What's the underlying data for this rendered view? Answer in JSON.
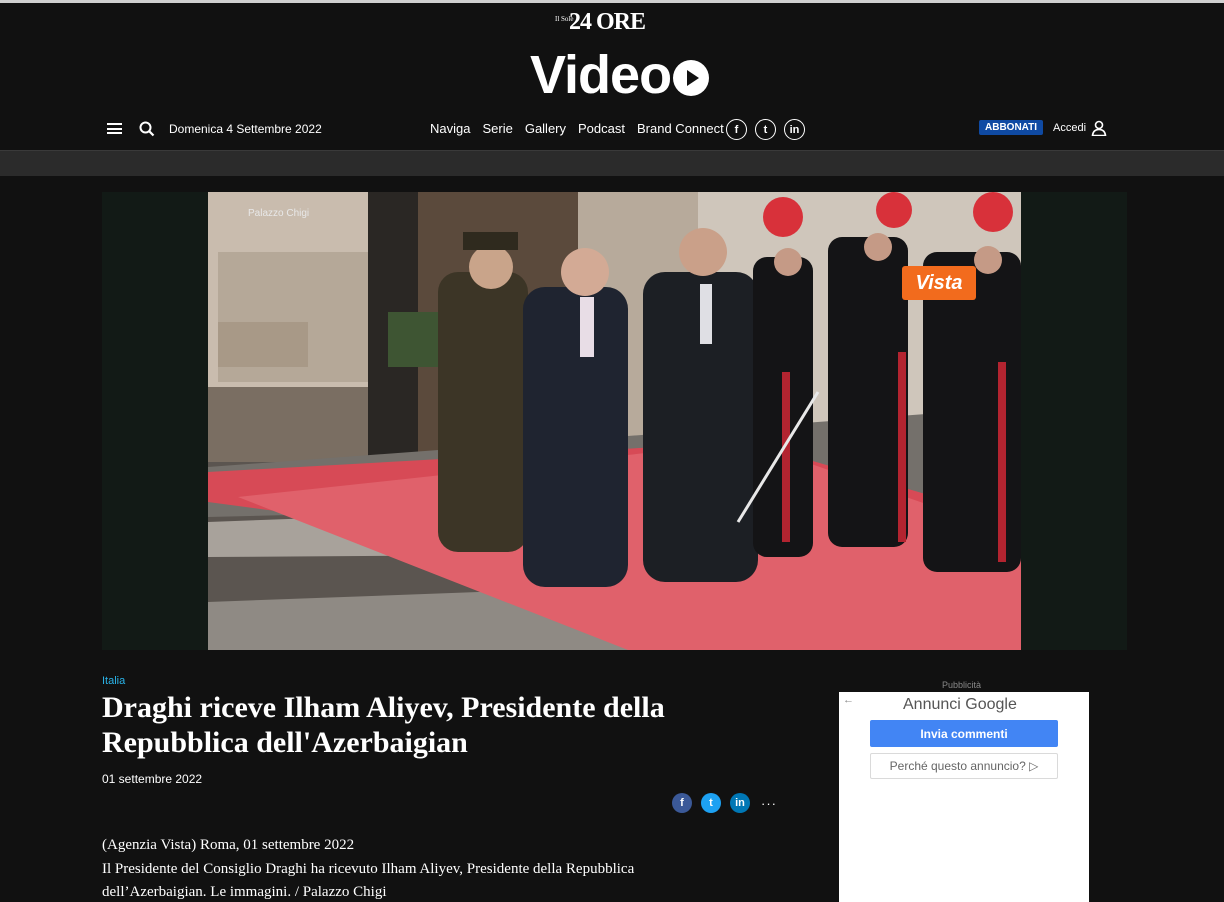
{
  "header": {
    "logo_sole_small": "Il Sole",
    "logo_sole_big": "24 ORE",
    "logo_video": "Video",
    "date": "Domenica 4 Settembre 2022",
    "nav": [
      "Naviga",
      "Serie",
      "Gallery",
      "Podcast",
      "Brand Connect"
    ],
    "social": [
      "f",
      "t",
      "in"
    ],
    "subscribe_label": "ABBONATI",
    "login_label": "Accedi"
  },
  "player": {
    "watermark": "Palazzo Chigi",
    "badge": "Vista"
  },
  "article": {
    "category": "Italia",
    "title": "Draghi riceve Ilham Aliyev, Presidente della Repubblica dell'Azerbaigian",
    "date": "01 settembre 2022",
    "share": [
      "f",
      "t",
      "in",
      "···"
    ],
    "body_line1": "(Agenzia Vista) Roma, 01 settembre 2022",
    "body_line2": "Il Presidente del Consiglio Draghi ha ricevuto Ilham Aliyev, Presidente della Repubblica dell’Azerbaigian. Le immagini. / Palazzo Chigi"
  },
  "ad": {
    "label": "Pubblicità",
    "back": "←",
    "annunci": "Annunci",
    "google": "Google",
    "send_feedback": "Invia commenti",
    "why": "Perché questo annuncio? ▷"
  }
}
